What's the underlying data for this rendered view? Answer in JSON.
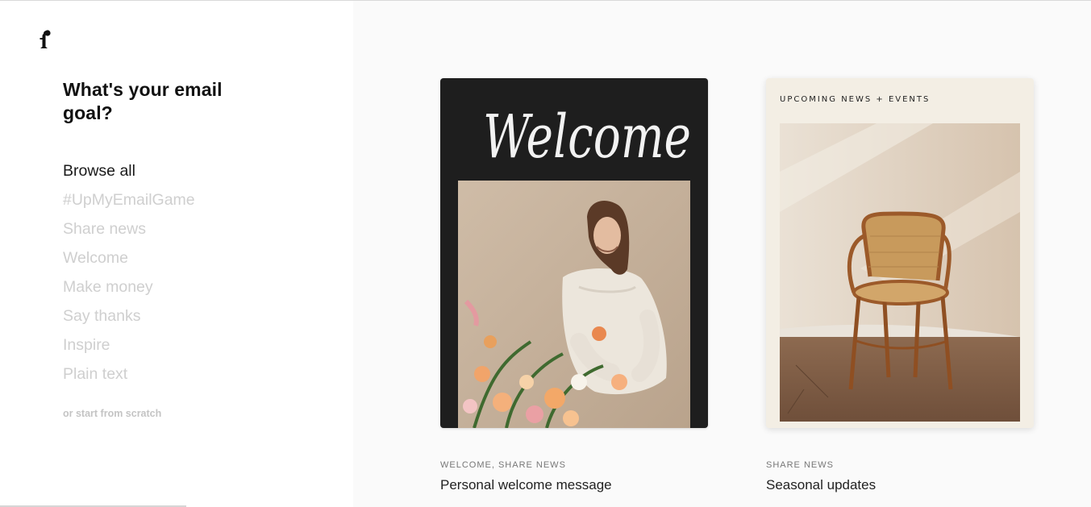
{
  "sidebar": {
    "title": "What's your email goal?",
    "goals": [
      {
        "label": "Browse all",
        "active": true
      },
      {
        "label": "#UpMyEmailGame",
        "active": false
      },
      {
        "label": "Share news",
        "active": false
      },
      {
        "label": "Welcome",
        "active": false
      },
      {
        "label": "Make money",
        "active": false
      },
      {
        "label": "Say thanks",
        "active": false
      },
      {
        "label": "Inspire",
        "active": false
      },
      {
        "label": "Plain text",
        "active": false
      }
    ],
    "scratch_link": "or start from scratch"
  },
  "templates": [
    {
      "tags": "WELCOME, SHARE NEWS",
      "name": "Personal welcome message",
      "script_heading": "Welcome",
      "image": "woman-arranging-flowers"
    },
    {
      "tags": "SHARE NEWS",
      "name": "Seasonal updates",
      "header": "UPCOMING NEWS + EVENTS",
      "image": "bentwood-cane-chair"
    }
  ],
  "colors": {
    "active_text": "#1a1a1a",
    "inactive_text": "#cfcfcf",
    "card_dark": "#1e1e1e",
    "card_cream": "#f3eee4"
  }
}
